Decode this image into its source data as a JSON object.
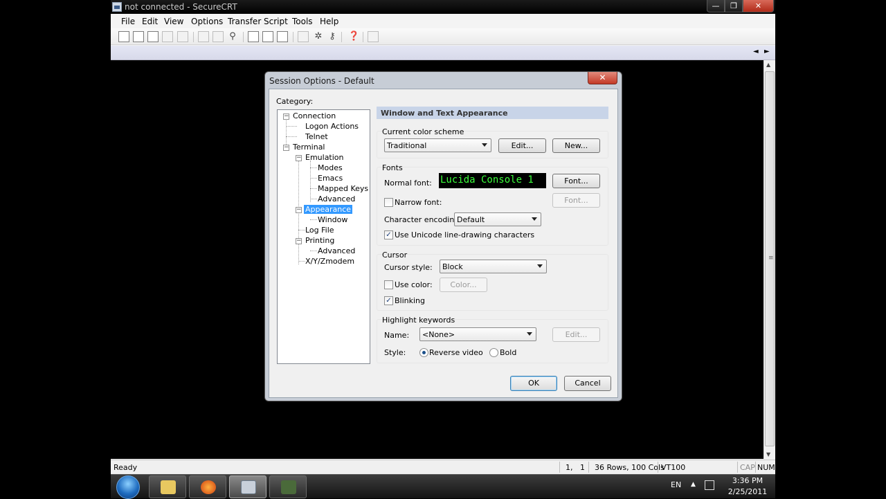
{
  "window": {
    "title": "not connected - SecureCRT"
  },
  "caption_buttons": {
    "minimize": "—",
    "maximize": "❐",
    "close": "✕"
  },
  "menu": [
    "File",
    "Edit",
    "View",
    "Options",
    "Transfer",
    "Script",
    "Tools",
    "Help"
  ],
  "toolbar": {
    "icons": [
      "connect-icon",
      "quick-connect-icon",
      "connect-in-tab-icon",
      "reconnect-icon",
      "disconnect-icon",
      "copy-icon",
      "paste-icon",
      "find-icon",
      "print-icon",
      "print-screen-icon",
      "print-preview-icon",
      "session-options-icon",
      "global-options-icon",
      "keymap-icon",
      "help-icon",
      "status-icon"
    ]
  },
  "tabs": {
    "scroll_left": "◄",
    "scroll_right": "►"
  },
  "scrollbar": {
    "up": "▲",
    "down": "▼",
    "grip": "≡"
  },
  "statusbar": {
    "ready": "Ready",
    "position": "1,   1",
    "size": "36 Rows, 100 Cols",
    "emulation": "VT100",
    "cap": "CAP",
    "num": "NUM"
  },
  "dialog": {
    "title": "Session Options - Default",
    "close": "✕",
    "category_label": "Category:",
    "tree": {
      "connection": "Connection",
      "logon_actions": "Logon Actions",
      "telnet": "Telnet",
      "terminal": "Terminal",
      "emulation": "Emulation",
      "modes": "Modes",
      "emacs": "Emacs",
      "mapped_keys": "Mapped Keys",
      "advanced": "Advanced",
      "appearance": "Appearance",
      "window": "Window",
      "log_file": "Log File",
      "printing": "Printing",
      "printing_advanced": "Advanced",
      "xyzmodem": "X/Y/Zmodem",
      "collapse": "−"
    },
    "panel_title": "Window and Text Appearance",
    "color_scheme": {
      "label": "Current color scheme",
      "value": "Traditional",
      "edit": "Edit...",
      "new": "New..."
    },
    "fonts": {
      "label": "Fonts",
      "normal_font_label": "Normal font:",
      "normal_font_preview": "Lucida Console 1",
      "font_button": "Font...",
      "narrow_font_label": "Narrow font:",
      "narrow_font_checked": false,
      "narrow_font_button": "Font...",
      "encoding_label": "Character encoding:",
      "encoding_value": "Default",
      "unicode_label": "Use Unicode line-drawing characters",
      "unicode_checked": true
    },
    "cursor": {
      "label": "Cursor",
      "style_label": "Cursor style:",
      "style_value": "Block",
      "use_color_label": "Use color:",
      "use_color_checked": false,
      "color_button": "Color...",
      "blinking_label": "Blinking",
      "blinking_checked": true
    },
    "highlight": {
      "label": "Highlight keywords",
      "name_label": "Name:",
      "name_value": "<None>",
      "edit": "Edit...",
      "style_label": "Style:",
      "reverse_video": "Reverse video",
      "bold": "Bold",
      "selected_style": "Reverse video"
    },
    "ok": "OK",
    "cancel": "Cancel",
    "check_mark": "✓"
  },
  "taskbar": {
    "language": "EN",
    "tray_arrow": "▲",
    "time": "3:36 PM",
    "date": "2/25/2011",
    "apps": [
      "explorer-icon",
      "firefox-icon",
      "securecrt-icon",
      "app-icon"
    ]
  }
}
